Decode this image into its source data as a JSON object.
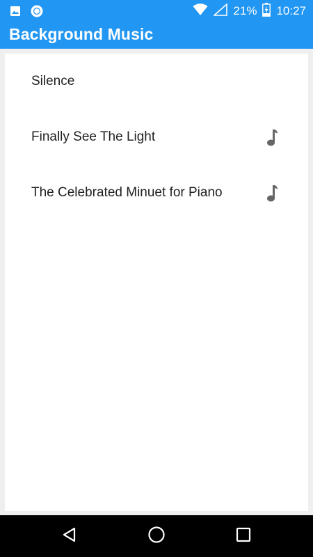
{
  "status_bar": {
    "battery": "21%",
    "time": "10:27",
    "icons": [
      "image-icon",
      "circle-notification-icon",
      "wifi-icon",
      "signal-icon",
      "battery-charging-icon"
    ]
  },
  "app_bar": {
    "title": "Background Music"
  },
  "music_list": {
    "items": [
      {
        "label": "Silence",
        "icon": null
      },
      {
        "label": "Finally See The Light",
        "icon": "music-note-icon"
      },
      {
        "label": "The Celebrated Minuet for Piano",
        "icon": "music-note-icon"
      }
    ]
  },
  "nav_bar": {
    "buttons": [
      "back-icon",
      "home-icon",
      "recents-icon"
    ]
  },
  "colors": {
    "primary": "#2196f3",
    "background": "#efefef",
    "card": "#ffffff",
    "text": "#212121",
    "icon": "#666666"
  }
}
